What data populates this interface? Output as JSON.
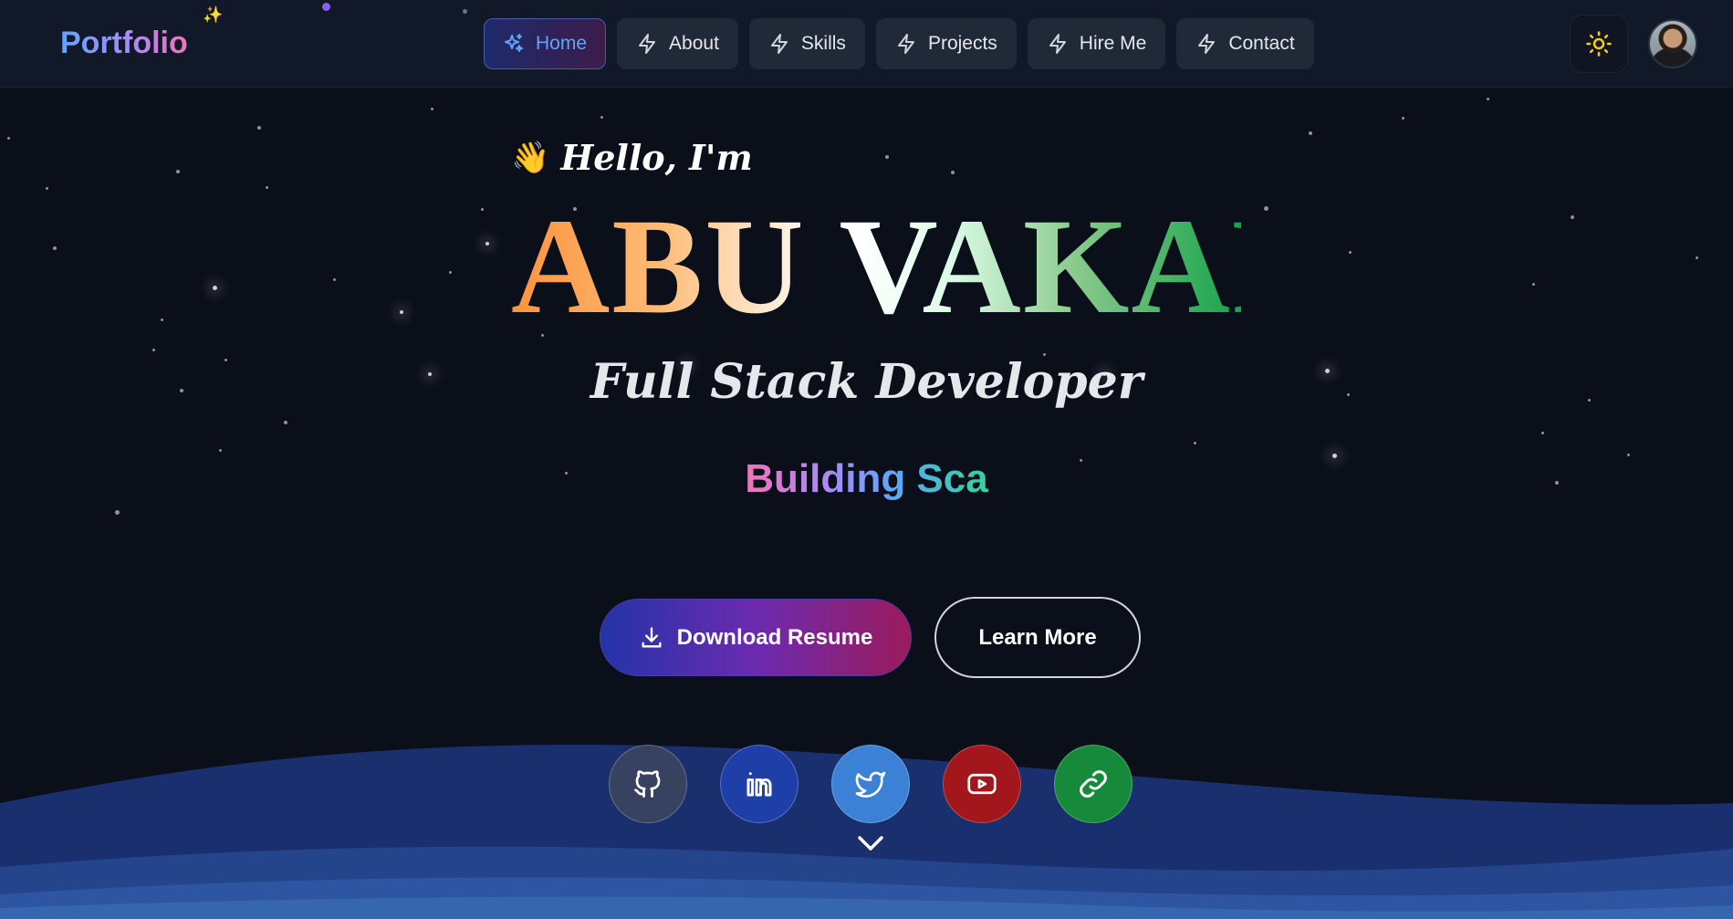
{
  "header": {
    "logo": "Portfolio",
    "nav": [
      {
        "label": "Home",
        "icon": "sparkles-icon",
        "active": true
      },
      {
        "label": "About",
        "icon": "bolt-icon",
        "active": false
      },
      {
        "label": "Skills",
        "icon": "bolt-icon",
        "active": false
      },
      {
        "label": "Projects",
        "icon": "bolt-icon",
        "active": false
      },
      {
        "label": "Hire Me",
        "icon": "bolt-icon",
        "active": false
      },
      {
        "label": "Contact",
        "icon": "bolt-icon",
        "active": false
      }
    ],
    "theme_toggle_icon": "sun-icon",
    "avatar_icon": "profile-avatar"
  },
  "hero": {
    "greeting": "Hello, I'm",
    "greeting_icon": "waving-hand-icon",
    "name": "ABU VAKAR",
    "role": "Full Stack Developer",
    "typing_text": "Building Sca"
  },
  "actions": {
    "download_label": "Download Resume",
    "download_icon": "download-icon",
    "learn_more_label": "Learn More"
  },
  "social": [
    {
      "name": "github",
      "icon": "github-icon",
      "color": "#374160"
    },
    {
      "name": "linkedin",
      "icon": "linkedin-icon",
      "color": "#1f3fa8"
    },
    {
      "name": "twitter",
      "icon": "twitter-icon",
      "color": "#3b82d6"
    },
    {
      "name": "youtube",
      "icon": "youtube-icon",
      "color": "#a3161c"
    },
    {
      "name": "link",
      "icon": "link-icon",
      "color": "#168a3a"
    }
  ],
  "scroll_indicator_icon": "chevron-down-icon",
  "colors": {
    "background": "#0b0f1a",
    "header": "#111827",
    "accent_blue": "#60a5fa",
    "accent_yellow": "#facc15"
  }
}
